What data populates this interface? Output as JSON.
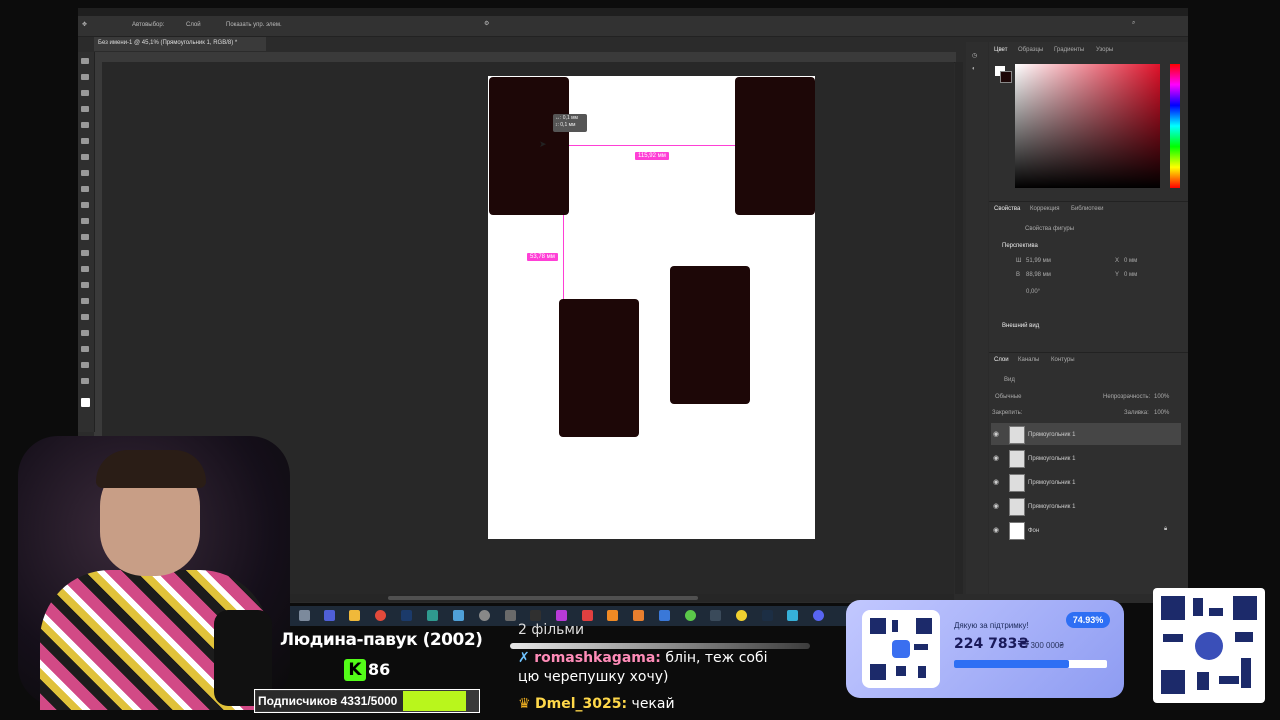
{
  "photoshop": {
    "doc_tab": "Без имени-1 @ 45,1% (Прямоугольник 1, RGB/8) *",
    "options": {
      "autoselect": "Автовыбор:",
      "autoselect_value": "Слой",
      "show_controls": "Показать упр. элем."
    },
    "measurements": {
      "horizontal": "115,92 мм",
      "vertical": "53,78 мм",
      "tooltip_line1": "↔: 0,1 мм",
      "tooltip_line2": "↕: 0,1 мм"
    },
    "color_panel": {
      "tabs": [
        "Цвет",
        "Образцы",
        "Градиенты",
        "Узоры"
      ]
    },
    "properties_panel": {
      "tabs": [
        "Свойства",
        "Коррекция",
        "Библиотеки"
      ],
      "shape_props": "Свойства фигуры",
      "section_transform": "Перспектива",
      "w_label": "Ш",
      "w_value": "51,99 мм",
      "h_label": "В",
      "h_value": "88,98 мм",
      "x_label": "X",
      "x_value": "0 мм",
      "y_label": "Y",
      "y_value": "0 мм",
      "angle_value": "0,00°",
      "section_appearance": "Внешний вид"
    },
    "layers_panel": {
      "tabs": [
        "Слои",
        "Каналы",
        "Контуры"
      ],
      "filter": "Вид",
      "blend_mode": "Обычные",
      "opacity_label": "Непрозрачность:",
      "opacity_value": "100%",
      "lock_label": "Закрепить:",
      "fill_label": "Заливка:",
      "fill_value": "100%",
      "layers": [
        {
          "name": "Прямоугольник 1",
          "selected": true
        },
        {
          "name": "Прямоугольник 1",
          "selected": false
        },
        {
          "name": "Прямоугольник 1",
          "selected": false
        },
        {
          "name": "Прямоугольник 1",
          "selected": false
        },
        {
          "name": "Фон",
          "selected": false
        }
      ]
    }
  },
  "stream": {
    "title": "Людина-павук (2002)",
    "viewers": "86",
    "subs_label": "Подписчиков 4331/5000",
    "chat": [
      {
        "user": "",
        "text": "2 фільми"
      },
      {
        "user": "romashkagama:",
        "text": "блін, теж собі цю черепушку хочу)"
      },
      {
        "user": "Dmel_3025:",
        "text": "чекай"
      }
    ],
    "donation": {
      "thanks": "Дякую за підтримку!",
      "amount": "224 783₴",
      "goal": "/ 300 000₴",
      "percent": "74.93%",
      "progress": 0.7493
    }
  },
  "colors": {
    "measure_magenta": "#ff3fd6",
    "rect_fill": "#1d0707",
    "kick_green": "#53fc18",
    "donate_blue": "#2e6ff4"
  }
}
